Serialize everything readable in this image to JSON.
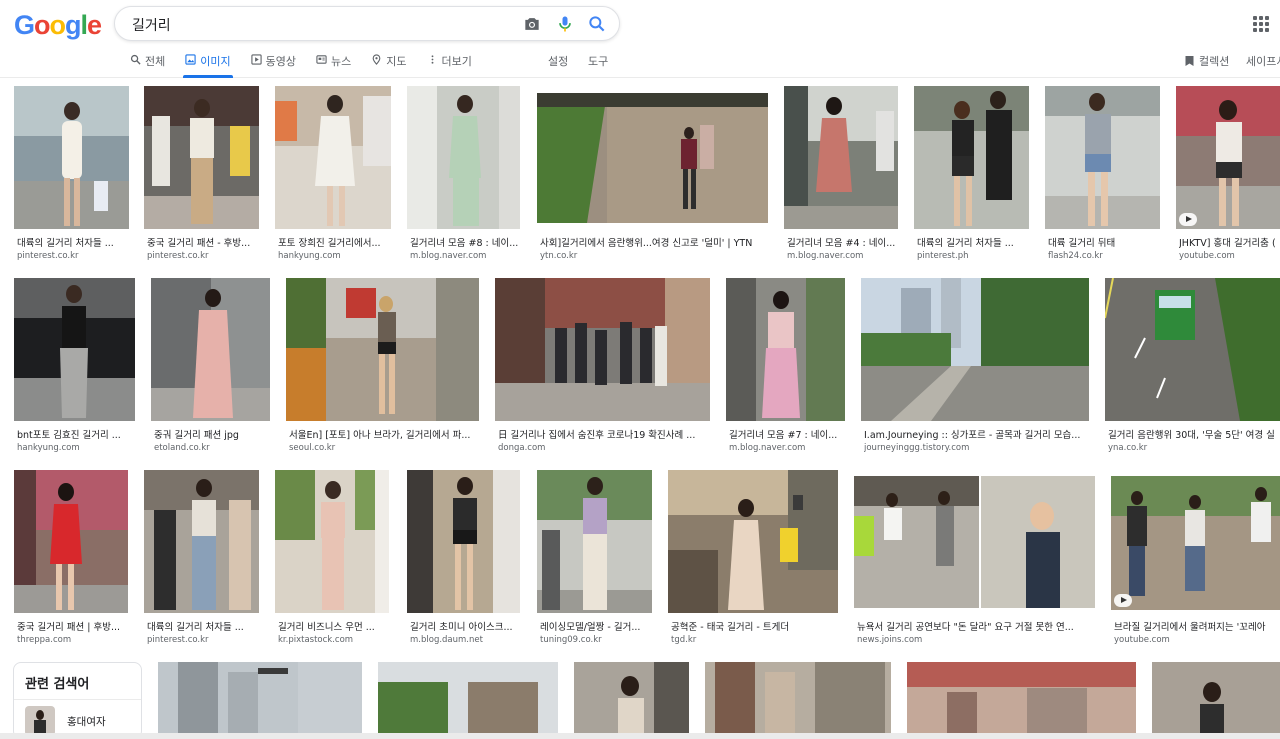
{
  "logo": {
    "text": "Google",
    "letters": [
      {
        "ch": "G",
        "color": "#4285F4"
      },
      {
        "ch": "o",
        "color": "#EA4335"
      },
      {
        "ch": "o",
        "color": "#FBBC05"
      },
      {
        "ch": "g",
        "color": "#4285F4"
      },
      {
        "ch": "l",
        "color": "#34A853"
      },
      {
        "ch": "e",
        "color": "#EA4335"
      }
    ]
  },
  "search": {
    "query": "길거리"
  },
  "tabs": [
    {
      "label": "전체",
      "icon": "search-icon",
      "active": false
    },
    {
      "label": "이미지",
      "icon": "image-icon",
      "active": true
    },
    {
      "label": "동영상",
      "icon": "video-icon",
      "active": false
    },
    {
      "label": "뉴스",
      "icon": "news-icon",
      "active": false
    },
    {
      "label": "지도",
      "icon": "map-pin-icon",
      "active": false
    },
    {
      "label": "더보기",
      "icon": "more-vert-icon",
      "active": false
    }
  ],
  "tools": {
    "settings": "설정",
    "tools": "도구"
  },
  "right": {
    "collections": "컬렉션",
    "safesearch": "세이프서"
  },
  "accent": "#1a73e8",
  "rows": [
    [
      {
        "caption": "대륙의 길거리 처자들 ...",
        "source": "pinterest.co.kr",
        "video": false
      },
      {
        "caption": "중국 길거리 패션 - 후방...",
        "source": "pinterest.co.kr",
        "video": false
      },
      {
        "caption": "포토 장희진 길거리에서...",
        "source": "hankyung.com",
        "video": false
      },
      {
        "caption": "길거리녀 모음 #8 : 네이...",
        "source": "m.blog.naver.com",
        "video": false
      },
      {
        "caption": "사회]길거리에서 음란행위...여경 신고로 '덜미' | YTN",
        "source": "ytn.co.kr",
        "video": false
      },
      {
        "caption": "길거리녀 모음 #4 : 네이...",
        "source": "m.blog.naver.com",
        "video": false
      },
      {
        "caption": "대륙의 길거리 처자들 ...",
        "source": "pinterest.ph",
        "video": false
      },
      {
        "caption": "대륙 길거리 뒤태",
        "source": "flash24.co.kr",
        "video": false
      },
      {
        "caption": "JHKTV] 홍대 길거리춤 (",
        "source": "youtube.com",
        "video": true
      }
    ],
    [
      {
        "caption": "bnt포토 김효진 길거리 ...",
        "source": "hankyung.com",
        "video": false
      },
      {
        "caption": "중궈 길거리 패션 jpg",
        "source": "etoland.co.kr",
        "video": false
      },
      {
        "caption": "서울En] [포토] 아나 브라가, 길거리에서 파...",
        "source": "seoul.co.kr",
        "video": false
      },
      {
        "caption": "日 길거리나 집에서 숨진후 코로나19 확진사례 ...",
        "source": "donga.com",
        "video": false
      },
      {
        "caption": "길거리녀 모음 #7 : 네이...",
        "source": "m.blog.naver.com",
        "video": false
      },
      {
        "caption": "I.am.Journeying :: 싱가포르 - 골목과 길거리 모습...",
        "source": "journeyinggg.tistory.com",
        "video": false
      },
      {
        "caption": "길거리 음란행위 30대, '무술 5단' 여경 실",
        "source": "yna.co.kr",
        "video": false
      }
    ],
    [
      {
        "caption": "중국 길거리 패션 | 후방...",
        "source": "threppa.com",
        "video": false
      },
      {
        "caption": "대륙의 길거리 처자들 ...",
        "source": "pinterest.co.kr",
        "video": false
      },
      {
        "caption": "길거리 비즈니스 우먼 ...",
        "source": "kr.pixtastock.com",
        "video": false
      },
      {
        "caption": "길거리 초미니 아이스크...",
        "source": "m.blog.daum.net",
        "video": false
      },
      {
        "caption": "레이싱모델/얼짱 - 길거...",
        "source": "tuning09.co.kr",
        "video": false
      },
      {
        "caption": "공혁준 - 태국 길거리 - 트게더",
        "source": "tgd.kr",
        "video": false
      },
      {
        "caption": "뉴욕서 길거리 공연보다 \"돈 달라\" 요구 거절 못한 연...",
        "source": "news.joins.com",
        "video": false
      },
      {
        "caption": "브라질 길거리에서 울려퍼지는 '꼬레아",
        "source": "youtube.com",
        "video": true
      }
    ]
  ],
  "related": {
    "title": "관련 검색어",
    "items": [
      {
        "label": "홍대여자"
      }
    ]
  }
}
